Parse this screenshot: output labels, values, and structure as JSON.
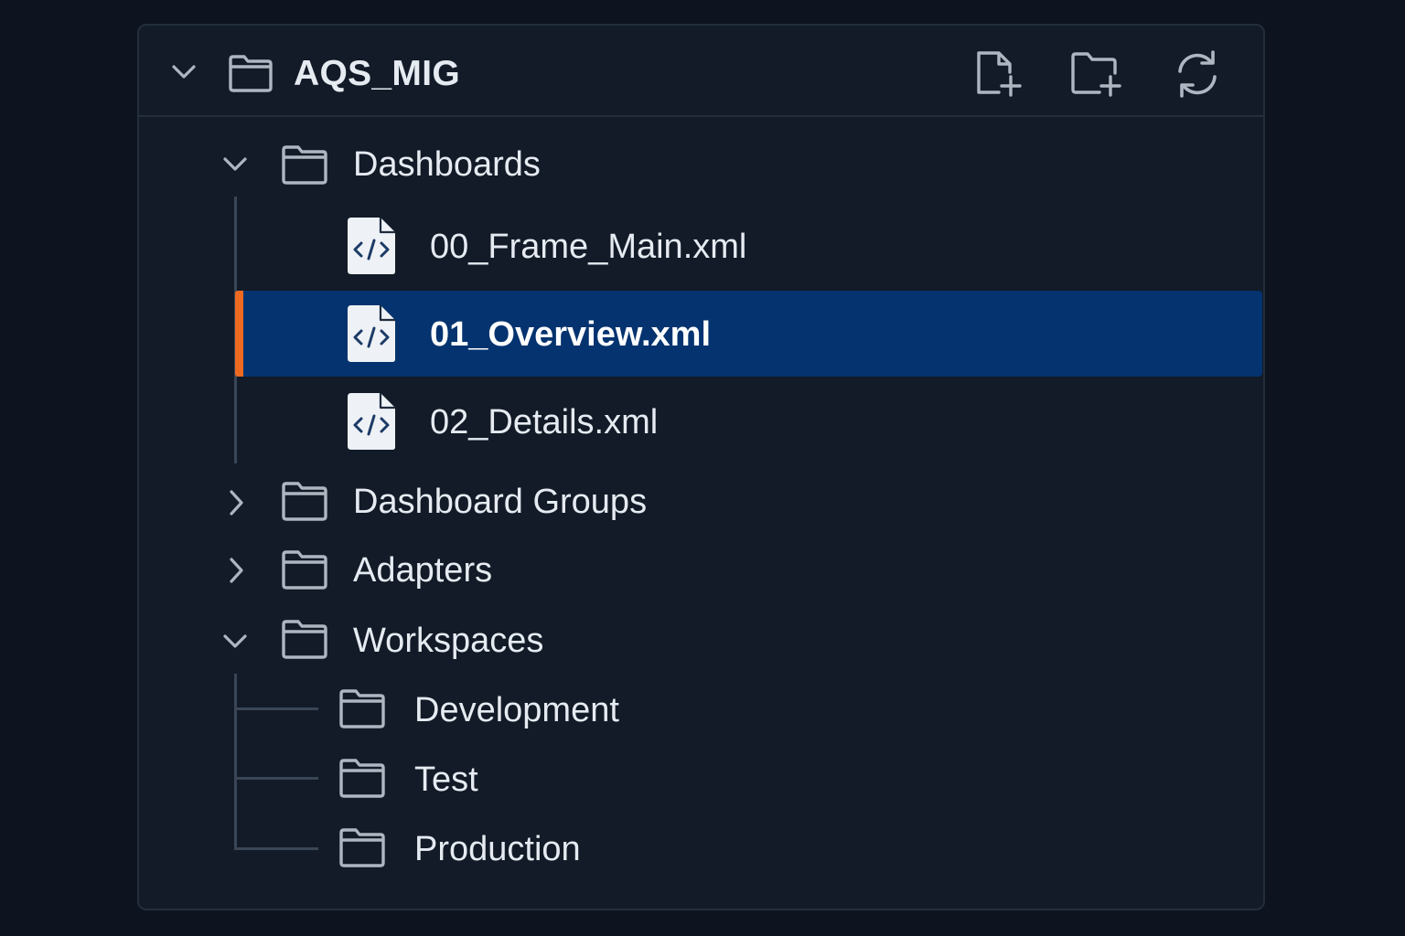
{
  "explorer": {
    "root": {
      "name": "AQS_MIG",
      "expanded": true,
      "icon": "folder-icon"
    },
    "toolbar": [
      {
        "name": "new-file",
        "icon": "new-file-icon"
      },
      {
        "name": "new-folder",
        "icon": "new-folder-icon"
      },
      {
        "name": "refresh",
        "icon": "refresh-icon"
      }
    ],
    "tree": {
      "dashboards": {
        "label": "Dashboards",
        "expanded": true,
        "files": [
          {
            "label": "00_Frame_Main.xml",
            "icon": "xml-file-icon",
            "selected": false
          },
          {
            "label": "01_Overview.xml",
            "icon": "xml-file-icon",
            "selected": true
          },
          {
            "label": "02_Details.xml",
            "icon": "xml-file-icon",
            "selected": false
          }
        ]
      },
      "dashboard_groups": {
        "label": "Dashboard Groups",
        "expanded": false
      },
      "adapters": {
        "label": "Adapters",
        "expanded": false
      },
      "workspaces": {
        "label": "Workspaces",
        "expanded": true,
        "children": [
          {
            "label": "Development"
          },
          {
            "label": "Test"
          },
          {
            "label": "Production"
          }
        ]
      }
    },
    "colors": {
      "background": "#0d141f",
      "panel": "#121b27",
      "selection": "#04336f",
      "selection_accent": "#ef6a21",
      "text": "#e6ebf2",
      "icon": "#aeb6c2"
    }
  }
}
